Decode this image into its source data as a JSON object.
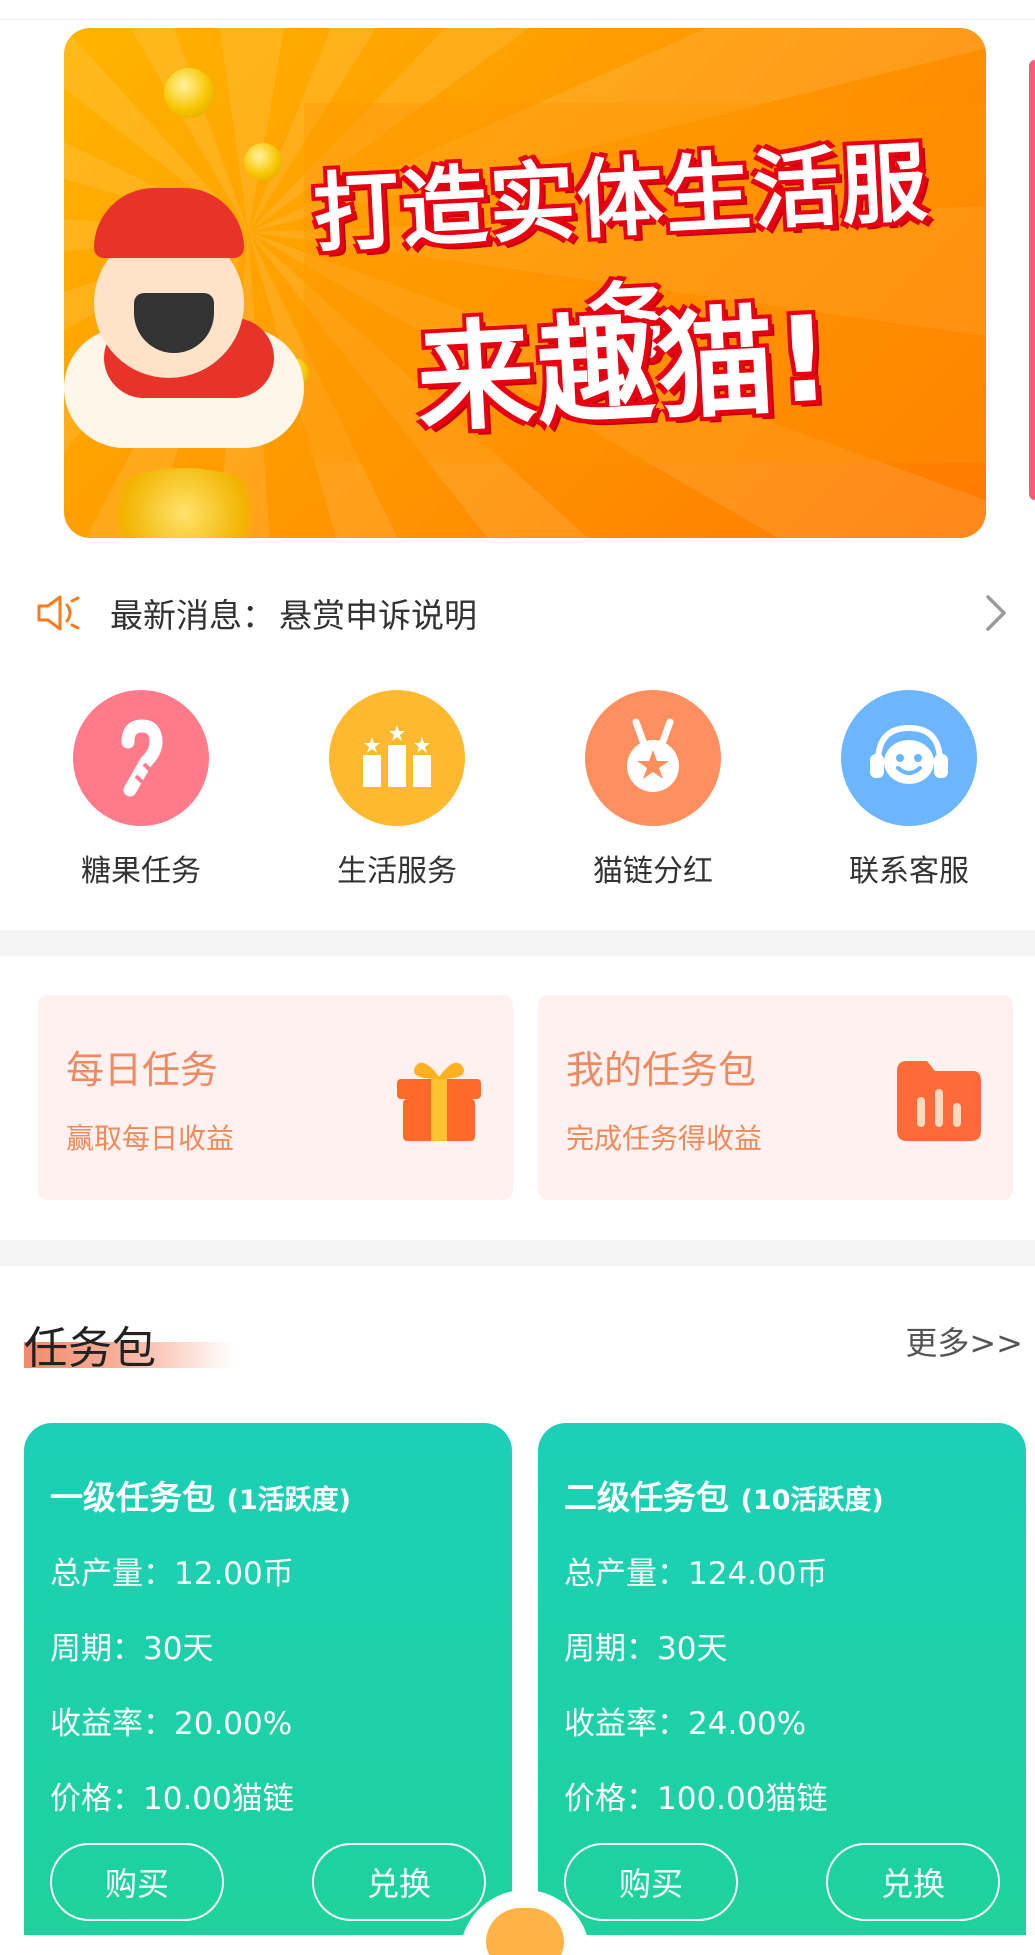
{
  "banner": {
    "line1": "打造实体生活服务",
    "line2": "来趣猫!"
  },
  "notice": {
    "label": "最新消息：",
    "title": "悬赏申诉说明"
  },
  "quick": [
    {
      "label": "糖果任务",
      "color": "#ff7b8c",
      "icon": "candy-cane-icon"
    },
    {
      "label": "生活服务",
      "color": "#ffb92e",
      "icon": "podium-stars-icon"
    },
    {
      "label": "猫链分红",
      "color": "#ff8f5e",
      "icon": "medal-icon"
    },
    {
      "label": "联系客服",
      "color": "#6cb6ff",
      "icon": "headset-smiley-icon"
    }
  ],
  "tasks": [
    {
      "title": "每日任务",
      "sub": "赢取每日收益",
      "icon": "gift-icon"
    },
    {
      "title": "我的任务包",
      "sub": "完成任务得收益",
      "icon": "folder-chart-icon"
    }
  ],
  "section": {
    "title": "任务包",
    "more": "更多>>"
  },
  "packages": [
    {
      "name": "一级任务包",
      "activity": "(1活跃度)",
      "output": "总产量：12.00币",
      "period": "周期：30天",
      "rate": "收益率：20.00%",
      "price": "价格：10.00猫链",
      "buy": "购买",
      "exchange": "兑换"
    },
    {
      "name": "二级任务包",
      "activity": "(10活跃度)",
      "output": "总产量：124.00币",
      "period": "周期：30天",
      "rate": "收益率：24.00%",
      "price": "价格：100.00猫链",
      "buy": "购买",
      "exchange": "兑换"
    }
  ],
  "colors": {
    "accent": "#ff8a00",
    "package_green": "#1fd0a8",
    "task_bg": "#fff1f0"
  }
}
